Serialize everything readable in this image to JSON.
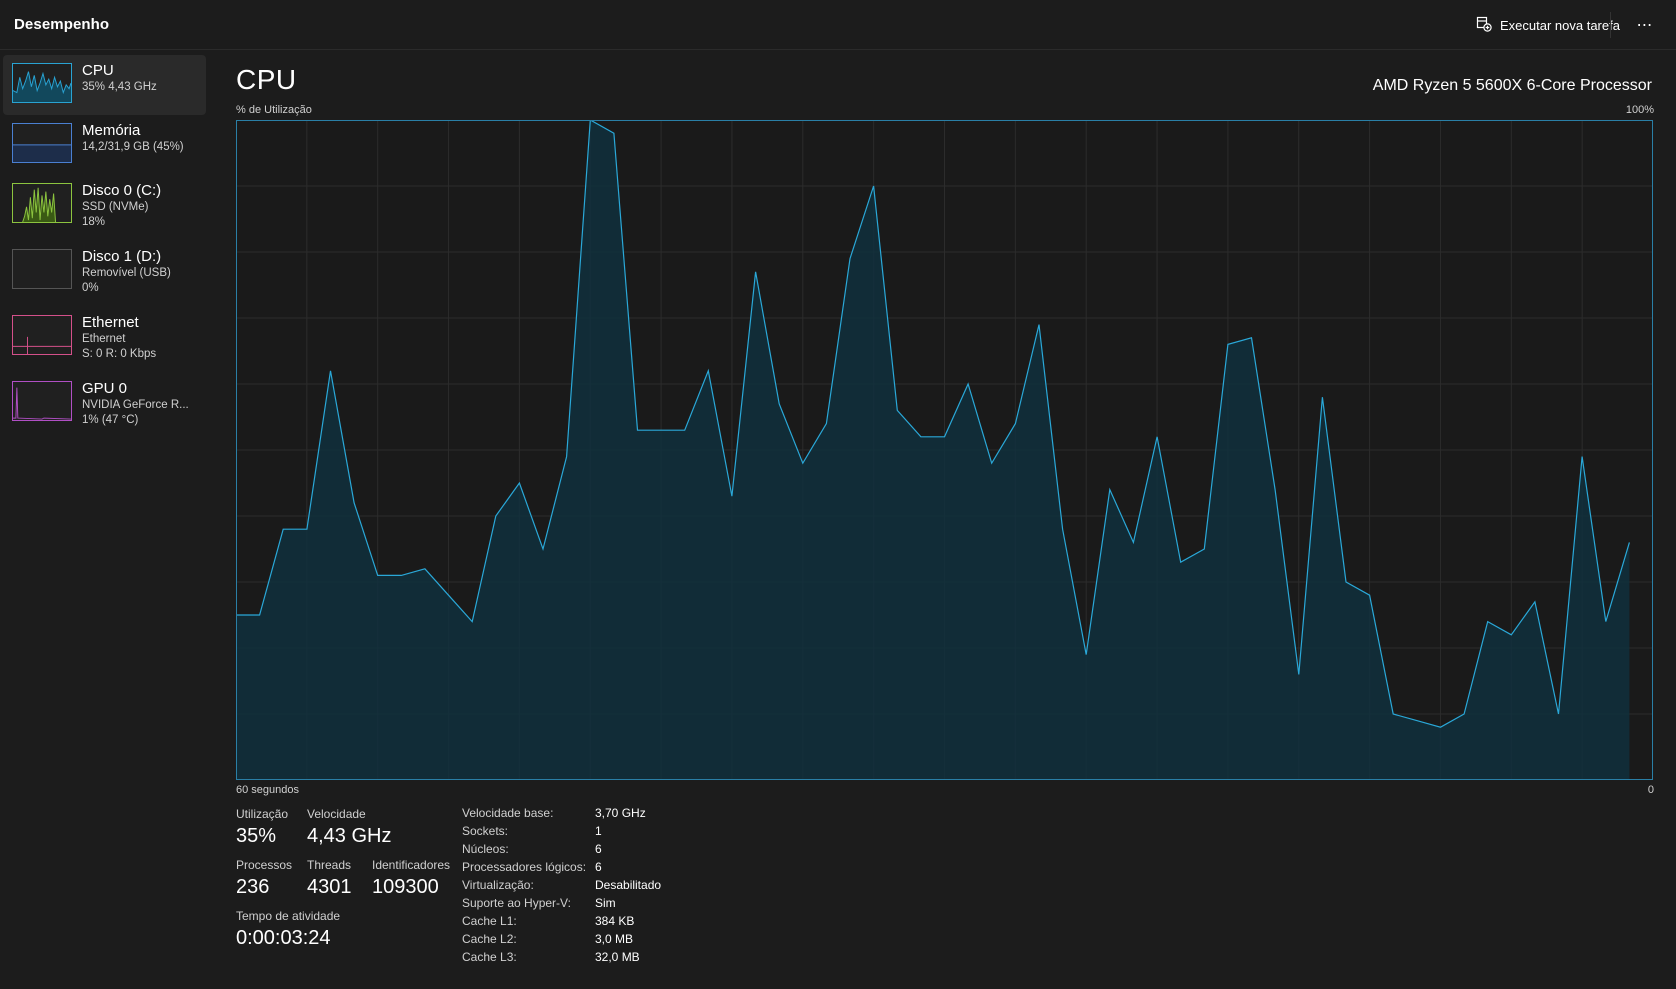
{
  "header": {
    "title": "Desempenho",
    "run_task_label": "Executar nova tarefa",
    "more_label": "⋯"
  },
  "sidebar": {
    "items": [
      {
        "name": "CPU",
        "sub1": "35% 4,43 GHz",
        "sub2": "",
        "color": "#29a3d3",
        "selected": true
      },
      {
        "name": "Memória",
        "sub1": "14,2/31,9 GB (45%)",
        "sub2": "",
        "color": "#4a7fd1",
        "selected": false
      },
      {
        "name": "Disco 0 (C:)",
        "sub1": "SSD (NVMe)",
        "sub2": "18%",
        "color": "#8cc43f",
        "selected": false
      },
      {
        "name": "Disco 1 (D:)",
        "sub1": "Removível (USB)",
        "sub2": "0%",
        "color": "#8cc43f",
        "selected": false
      },
      {
        "name": "Ethernet",
        "sub1": "Ethernet",
        "sub2": "S: 0 R: 0 Kbps",
        "color": "#d4508a",
        "selected": false
      },
      {
        "name": "GPU 0",
        "sub1": "NVIDIA GeForce R...",
        "sub2": "1% (47 °C)",
        "color": "#b04fc4",
        "selected": false
      }
    ]
  },
  "main": {
    "title": "CPU",
    "processor": "AMD Ryzen 5 5600X 6-Core Processor",
    "y_label": "% de Utilização",
    "y_max_label": "100%",
    "x_label": "60 segundos",
    "x_min_label": "0"
  },
  "chart_data": {
    "type": "area",
    "title": "",
    "xlabel": "60 segundos",
    "ylabel": "% de Utilização",
    "ylim": [
      0,
      100
    ],
    "xlim": [
      60,
      0
    ],
    "grid": true,
    "line_color": "#2aa8d8",
    "fill_color": "#11303d",
    "x": [
      60,
      59,
      58,
      57,
      56,
      55,
      54,
      53,
      52,
      51,
      50,
      49,
      48,
      47,
      46,
      45,
      44,
      43,
      42,
      41,
      40,
      39,
      38,
      37,
      36,
      35,
      34,
      33,
      32,
      31,
      30,
      29,
      28,
      27,
      26,
      25,
      24,
      23,
      22,
      21,
      20,
      19,
      18,
      17,
      16,
      15,
      14,
      13,
      12,
      11,
      10,
      9,
      8,
      7,
      6,
      5,
      4,
      3,
      2,
      1,
      0
    ],
    "values": [
      25,
      25,
      38,
      38,
      62,
      42,
      31,
      31,
      32,
      28,
      24,
      40,
      45,
      35,
      49,
      100,
      98,
      53,
      53,
      53,
      62,
      43,
      77,
      57,
      48,
      54,
      79,
      90,
      56,
      52,
      52,
      60,
      48,
      54,
      69,
      38,
      19,
      44,
      36,
      52,
      33,
      35,
      66,
      67,
      44,
      16,
      58,
      30,
      28,
      10,
      9,
      8,
      10,
      24,
      22,
      27,
      10,
      49,
      24,
      36
    ],
    "stats": {
      "utilizacao": "35%",
      "velocidade": "4,43 GHz"
    }
  },
  "stats": {
    "utilization_label": "Utilização",
    "utilization_value": "35%",
    "speed_label": "Velocidade",
    "speed_value": "4,43 GHz",
    "processes_label": "Processos",
    "processes_value": "236",
    "threads_label": "Threads",
    "threads_value": "4301",
    "handles_label": "Identificadores",
    "handles_value": "109300",
    "uptime_label": "Tempo de atividade",
    "uptime_value": "0:00:03:24"
  },
  "info": [
    {
      "k": "Velocidade base:",
      "v": "3,70 GHz"
    },
    {
      "k": "Sockets:",
      "v": "1"
    },
    {
      "k": "Núcleos:",
      "v": "6"
    },
    {
      "k": "Processadores lógicos:",
      "v": "6"
    },
    {
      "k": "Virtualização:",
      "v": "Desabilitado"
    },
    {
      "k": "Suporte ao Hyper-V:",
      "v": "Sim"
    },
    {
      "k": "Cache L1:",
      "v": "384 KB"
    },
    {
      "k": "Cache L2:",
      "v": "3,0 MB"
    },
    {
      "k": "Cache L3:",
      "v": "32,0 MB"
    }
  ]
}
